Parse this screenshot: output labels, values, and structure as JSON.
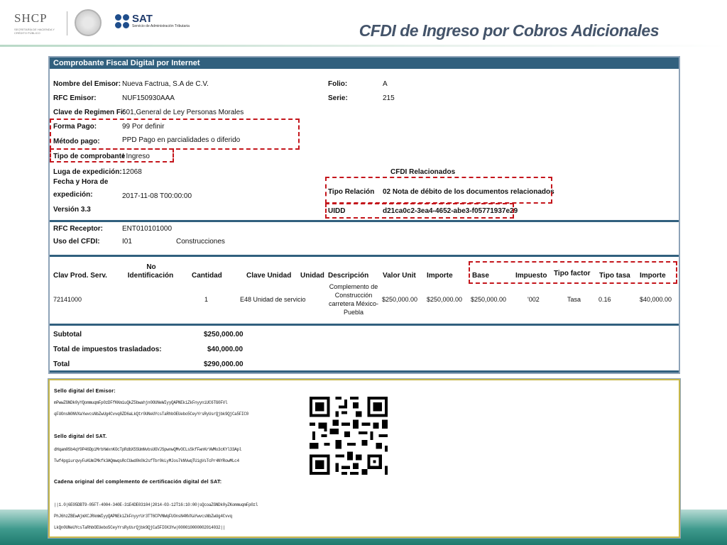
{
  "header": {
    "shcp_title": "SHCP",
    "shcp_sub": "SECRETARÍA DE HACIENDA Y CRÉDITO PÚBLICO",
    "sat_name": "SAT",
    "sat_sub": "Servicio de Administración Tributaria",
    "slide_title": "CFDI de Ingreso por Cobros Adicionales"
  },
  "invoice": {
    "header_title": "Comprobante Fiscal Digital por Internet",
    "emisor_label": "Nombre del Emisor:",
    "emisor_value": "Nueva Factrua, S.A de C.V.",
    "rfc_emisor_label": "RFC Emisor:",
    "rfc_emisor_value": "NUF150930AAA",
    "regimen_label": "Clave de Regimen Fi:",
    "regimen_value": "601,General de Ley Personas Morales",
    "forma_pago_label": "Forma Pago:",
    "forma_pago_value": "99 Por definir",
    "metodo_pago_label": "Método pago:",
    "metodo_pago_value": "PPD Pago en parcialidades o diferido",
    "tipo_comp_label": "Tipo de comprobante",
    "tipo_comp_value": "I  Ingreso",
    "lugar_label": "Luga de expedición:",
    "lugar_value": "12068",
    "fecha_label_1": "Fecha y Hora de",
    "fecha_label_2": "expedición:",
    "fecha_value": "2017-11-08 T00:00:00",
    "version_label": "Versión 3.3",
    "folio_label": "Folio:",
    "folio_value": "A",
    "serie_label": "Serie:",
    "serie_value": "215",
    "relacionados_title": "CFDI Relacionados",
    "tipo_relacion_label": "Tipo Relación",
    "tipo_relacion_value": "02 Nota de débito de los documentos relacionados",
    "uuid_label": "UIDD",
    "uuid_value": "d21ca0c2-3ea4-4652-abe3-f05771937e29",
    "rfc_receptor_label": "RFC Receptor:",
    "rfc_receptor_value": "ENT010101000",
    "uso_cfdi_label": "Uso del CFDI:",
    "uso_cfdi_code": "I01",
    "uso_cfdi_value": "Construcciones",
    "columns": {
      "clav_prod": "Clav Prod. Serv.",
      "no_ident_1": "No",
      "no_ident_2": "Identificación",
      "cantidad": "Cantidad",
      "clave_unidad": "Clave Unidad",
      "unidad": "Unidad",
      "descripcion": "Descripción",
      "valor_unit": "Valor Unit",
      "importe": "Importe",
      "base": "Base",
      "impuesto": "Impuesto",
      "tipo_factor": "Tipo factor",
      "tipo_tasa": "Tipo tasa",
      "importe2": "Importe"
    },
    "row": {
      "clav_prod": "72141000",
      "cantidad": "1",
      "clave_unidad": "E48 Unidad de servicio",
      "descripcion_1": "Complemento de",
      "descripcion_2": "Construcción",
      "descripcion_3": "carretera México-",
      "descripcion_4": "Puebla",
      "valor_unit": "$250,000.00",
      "importe": "$250,000.00",
      "base": "$250,000.00",
      "impuesto": "'002",
      "tipo_factor": "Tasa",
      "tipo_tasa": "0.16",
      "importe2": "$40,000.00"
    },
    "subtotal_label": "Subtotal",
    "subtotal_value": "$250,000.00",
    "impuestos_label": "Total de impuestos trasladados:",
    "impuestos_value": "$40,000.00",
    "total_label": "Total",
    "total_value": "$290,000.00"
  },
  "seals": {
    "emisor_label": "Sello digital del Emisor:",
    "emisor_line_1": "mPwwZGNDk0yYQommuqmFp0zDFfKKmiuQkZ5bwahjn0OUNeWIyyQAPNEkiZkFnyyniUC6TG0FVl",
    "emisor_line_2": "qFUOnsN0NVXaYwvcsNbZwUg4Cvvq8ZD6aLkQtr0UNeUYcsTaRhbOEUebo5CeyYrsRyUsrQjbk9QjCa5FIC0",
    "sat_label": "Sello digital del SAT.",
    "sat_line_1": "dHqam0Sb4qY9P46DpiMrbhWxnKOcTpRdbX5SUmNvbsUGVJSpwnwQMvOCLsSkfFwnKrVWMo3cKYl33Apl",
    "sat_line_2": "Twf4pgiurqvyFuKUmIMkfk3AQmwqsRcCUwd0k0k2sfTbr0kLyMJos7kNVwqTUigVsTcPr4NYRowMLc4",
    "cadena_label": "Cadena original del complemento de certificación digital del SAT:",
    "cadena_line_1": "||1.0|6E05DBT9-05FT-4004-340E-31E4DE03104|2014-03-12T16:10:00|sQcoaZGNDk0yZKommuqmFp0zl",
    "cadena_line_2": "PhJ6hzZBEwAjmXCJRkmWIyyQAPNEkiZkFnyyrUr3TT6CPVNWqFUOnsN4NVXaYwvcsNbZwUg4Cvvq",
    "cadena_line_3": "LkQn0UNeUYcsTaRhbOEUebo5CeyYrsRyUsrQjbk9QjCa5FI0X3Yw|000010000002014032||"
  },
  "colors": {
    "title_text": "#44546a",
    "table_header": "#31607e",
    "highlight_dash": "#c4161c",
    "band": "#3f9a8d"
  },
  "icons": {
    "qr": "qr-code",
    "shcp": "mexican-coat-of-arms-seal",
    "sat": "sat-logo"
  }
}
